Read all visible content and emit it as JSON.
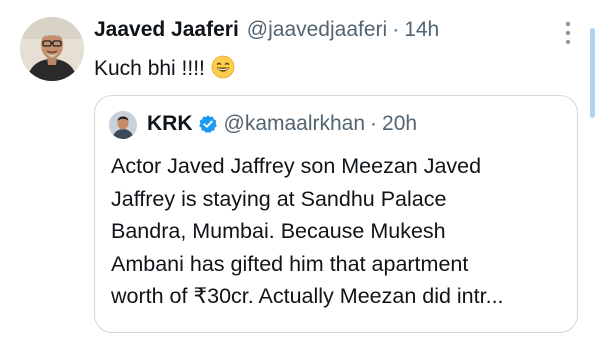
{
  "tweet": {
    "display_name": "Jaaved Jaaferi",
    "handle": "@jaavedjaaferi",
    "separator": "·",
    "time": "14h",
    "text": "Kuch bhi !!!!",
    "emoji_icon": "grinning-face-icon"
  },
  "quoted_tweet": {
    "display_name": "KRK",
    "verified_icon": "verified-badge-icon",
    "handle": "@kamaalrkhan",
    "separator": "·",
    "time": "20h",
    "lines": [
      "Actor Javed Jaffrey son Meezan Javed",
      "Jaffrey is staying at Sandhu Palace",
      "Bandra, Mumbai. Because Mukesh",
      "Ambani has gifted him that apartment",
      "worth of ₹30cr. Actually Meezan did intr..."
    ]
  },
  "icons": {
    "more": "more-options-icon"
  },
  "colors": {
    "text_primary": "#0f1419",
    "text_secondary": "#536471",
    "verified_blue": "#1d9bf0",
    "border": "#cfd9de"
  }
}
